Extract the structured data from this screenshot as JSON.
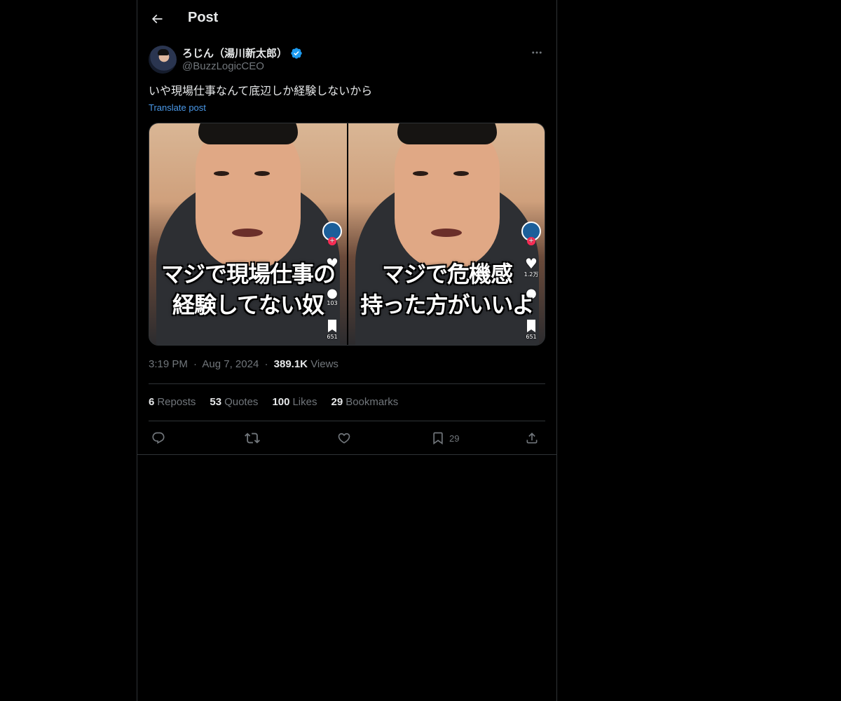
{
  "header": {
    "title": "Post",
    "back_icon": "arrow-left-icon"
  },
  "post": {
    "author": {
      "display_name": "ろじん（湯川新太郎）",
      "handle": "@BuzzLogicCEO",
      "verified": true,
      "verified_color": "#1d9bf0"
    },
    "text": "いや現場仕事なんて底辺しか経験しないから",
    "translate_label": "Translate post",
    "media": {
      "left_frame": {
        "caption_line1": "マジで現場仕事の",
        "caption_line2": "経験してない奴",
        "likes": "",
        "comments": "103",
        "saves": "651"
      },
      "right_frame": {
        "caption_line1": "マジで危機感",
        "caption_line2": "持った方がいいよ",
        "likes": "1.2万",
        "comments": "",
        "saves": "651"
      }
    },
    "time": "3:19 PM",
    "date": "Aug 7, 2024",
    "views_count": "389.1K",
    "views_label": "Views",
    "dot": "·"
  },
  "stats": {
    "reposts_count": "6",
    "reposts_label": "Reposts",
    "quotes_count": "53",
    "quotes_label": "Quotes",
    "likes_count": "100",
    "likes_label": "Likes",
    "bookmarks_count": "29",
    "bookmarks_label": "Bookmarks"
  },
  "actions": {
    "bookmark_count": "29"
  },
  "colors": {
    "background": "#000000",
    "text_primary": "#e7e9ea",
    "text_secondary": "#71767b",
    "link": "#4a99e9",
    "border": "#2f3336"
  }
}
